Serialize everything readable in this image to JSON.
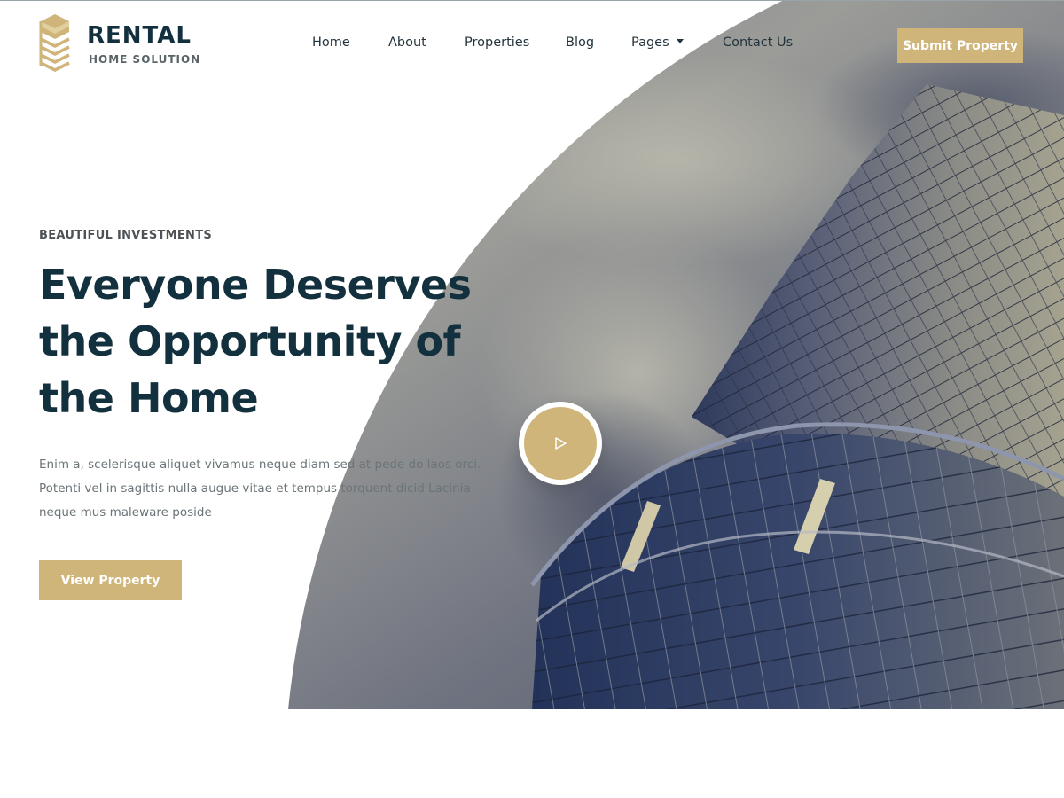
{
  "brand": {
    "name": "RENTAL",
    "tagline": "HOME SOLUTION",
    "accent_color": "#cfb57a",
    "text_color": "#13303e"
  },
  "nav": {
    "items": [
      {
        "label": "Home"
      },
      {
        "label": "About"
      },
      {
        "label": "Properties"
      },
      {
        "label": "Blog"
      },
      {
        "label": "Pages",
        "dropdown": true
      },
      {
        "label": "Contact Us"
      }
    ],
    "cta_label": "Submit Property"
  },
  "hero": {
    "eyebrow": "BEAUTIFUL INVESTMENTS",
    "headline_lines": [
      "Everyone Deserves",
      "the Opportunity of",
      "the Home"
    ],
    "description_lines": [
      "Enim a, scelerisque aliquet vivamus neque diam sed at pede do laos orci.",
      "Potenti vel in sagittis nulla augue vitae et tempus torquent dicid Lacinia",
      "neque mus maleware poside"
    ],
    "button_label": "View Property",
    "play_icon": "play-icon",
    "image_subject": "glass-skyscraper"
  }
}
